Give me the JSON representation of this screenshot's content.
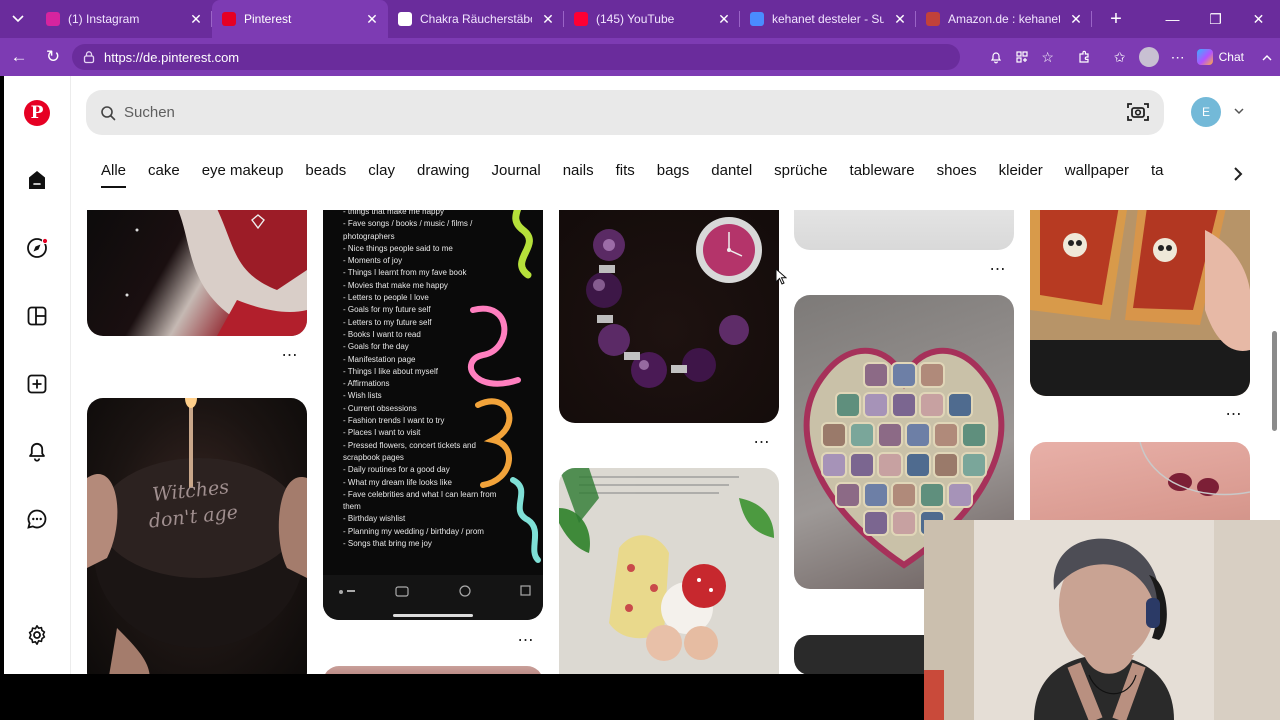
{
  "browser": {
    "tabs": [
      {
        "title": "(1) Instagram",
        "icon": "instagram-icon",
        "color": "#d6249f",
        "active": false
      },
      {
        "title": "Pinterest",
        "icon": "pinterest-icon",
        "color": "#e60023",
        "active": true
      },
      {
        "title": "Chakra Räucherstäbchen",
        "icon": "shop-icon",
        "color": "#ffffff",
        "active": false
      },
      {
        "title": "(145) YouTube",
        "icon": "youtube-icon",
        "color": "#ff0033",
        "active": false
      },
      {
        "title": "kehanet desteler - Such",
        "icon": "search-icon",
        "color": "#4a8cff",
        "active": false
      },
      {
        "title": "Amazon.de : kehanet de",
        "icon": "amazon-icon",
        "color": "#c2413a",
        "active": false
      }
    ],
    "url": "https://de.pinterest.com",
    "chat_label": "Chat"
  },
  "search": {
    "placeholder": "Suchen"
  },
  "user": {
    "initial": "E"
  },
  "categories": [
    "Alle",
    "cake",
    "eye makeup",
    "beads",
    "clay",
    "drawing",
    "Journal",
    "nails",
    "fits",
    "bags",
    "dantel",
    "sprüche",
    "tableware",
    "shoes",
    "kleider",
    "wallpaper",
    "ta"
  ],
  "pins": {
    "journal_list": [
      "things that make me happy",
      "Fave songs / books / music / films /",
      "   photographers",
      "Nice things people said to me",
      "Moments of joy",
      "Things I learnt from my fave book",
      "Movies that make me happy",
      "Letters to people I love",
      "Goals for my future self",
      "Letters to my future self",
      "Books I want to read",
      "Goals for the day",
      "Manifestation page",
      "Things I like about myself",
      "Affirmations",
      "Wish lists",
      "Current obsessions",
      "Fashion trends I want to try",
      "Places I want to visit",
      "Pressed flowers, concert tickets and",
      "   scrapbook pages",
      "Daily routines for a good day",
      "What my dream life looks like",
      "Fave celebrities and what I can learn from",
      "   them",
      "Birthday wishlist",
      "Planning my wedding / birthday / prom",
      "Songs that bring me joy"
    ],
    "cake_text": "Witches don't age"
  },
  "colors": {
    "chrome_dark": "#6a2c9c",
    "chrome_light": "#7d3bb3",
    "pinterest_red": "#e60023",
    "avatar_blue": "#73b9d8"
  }
}
